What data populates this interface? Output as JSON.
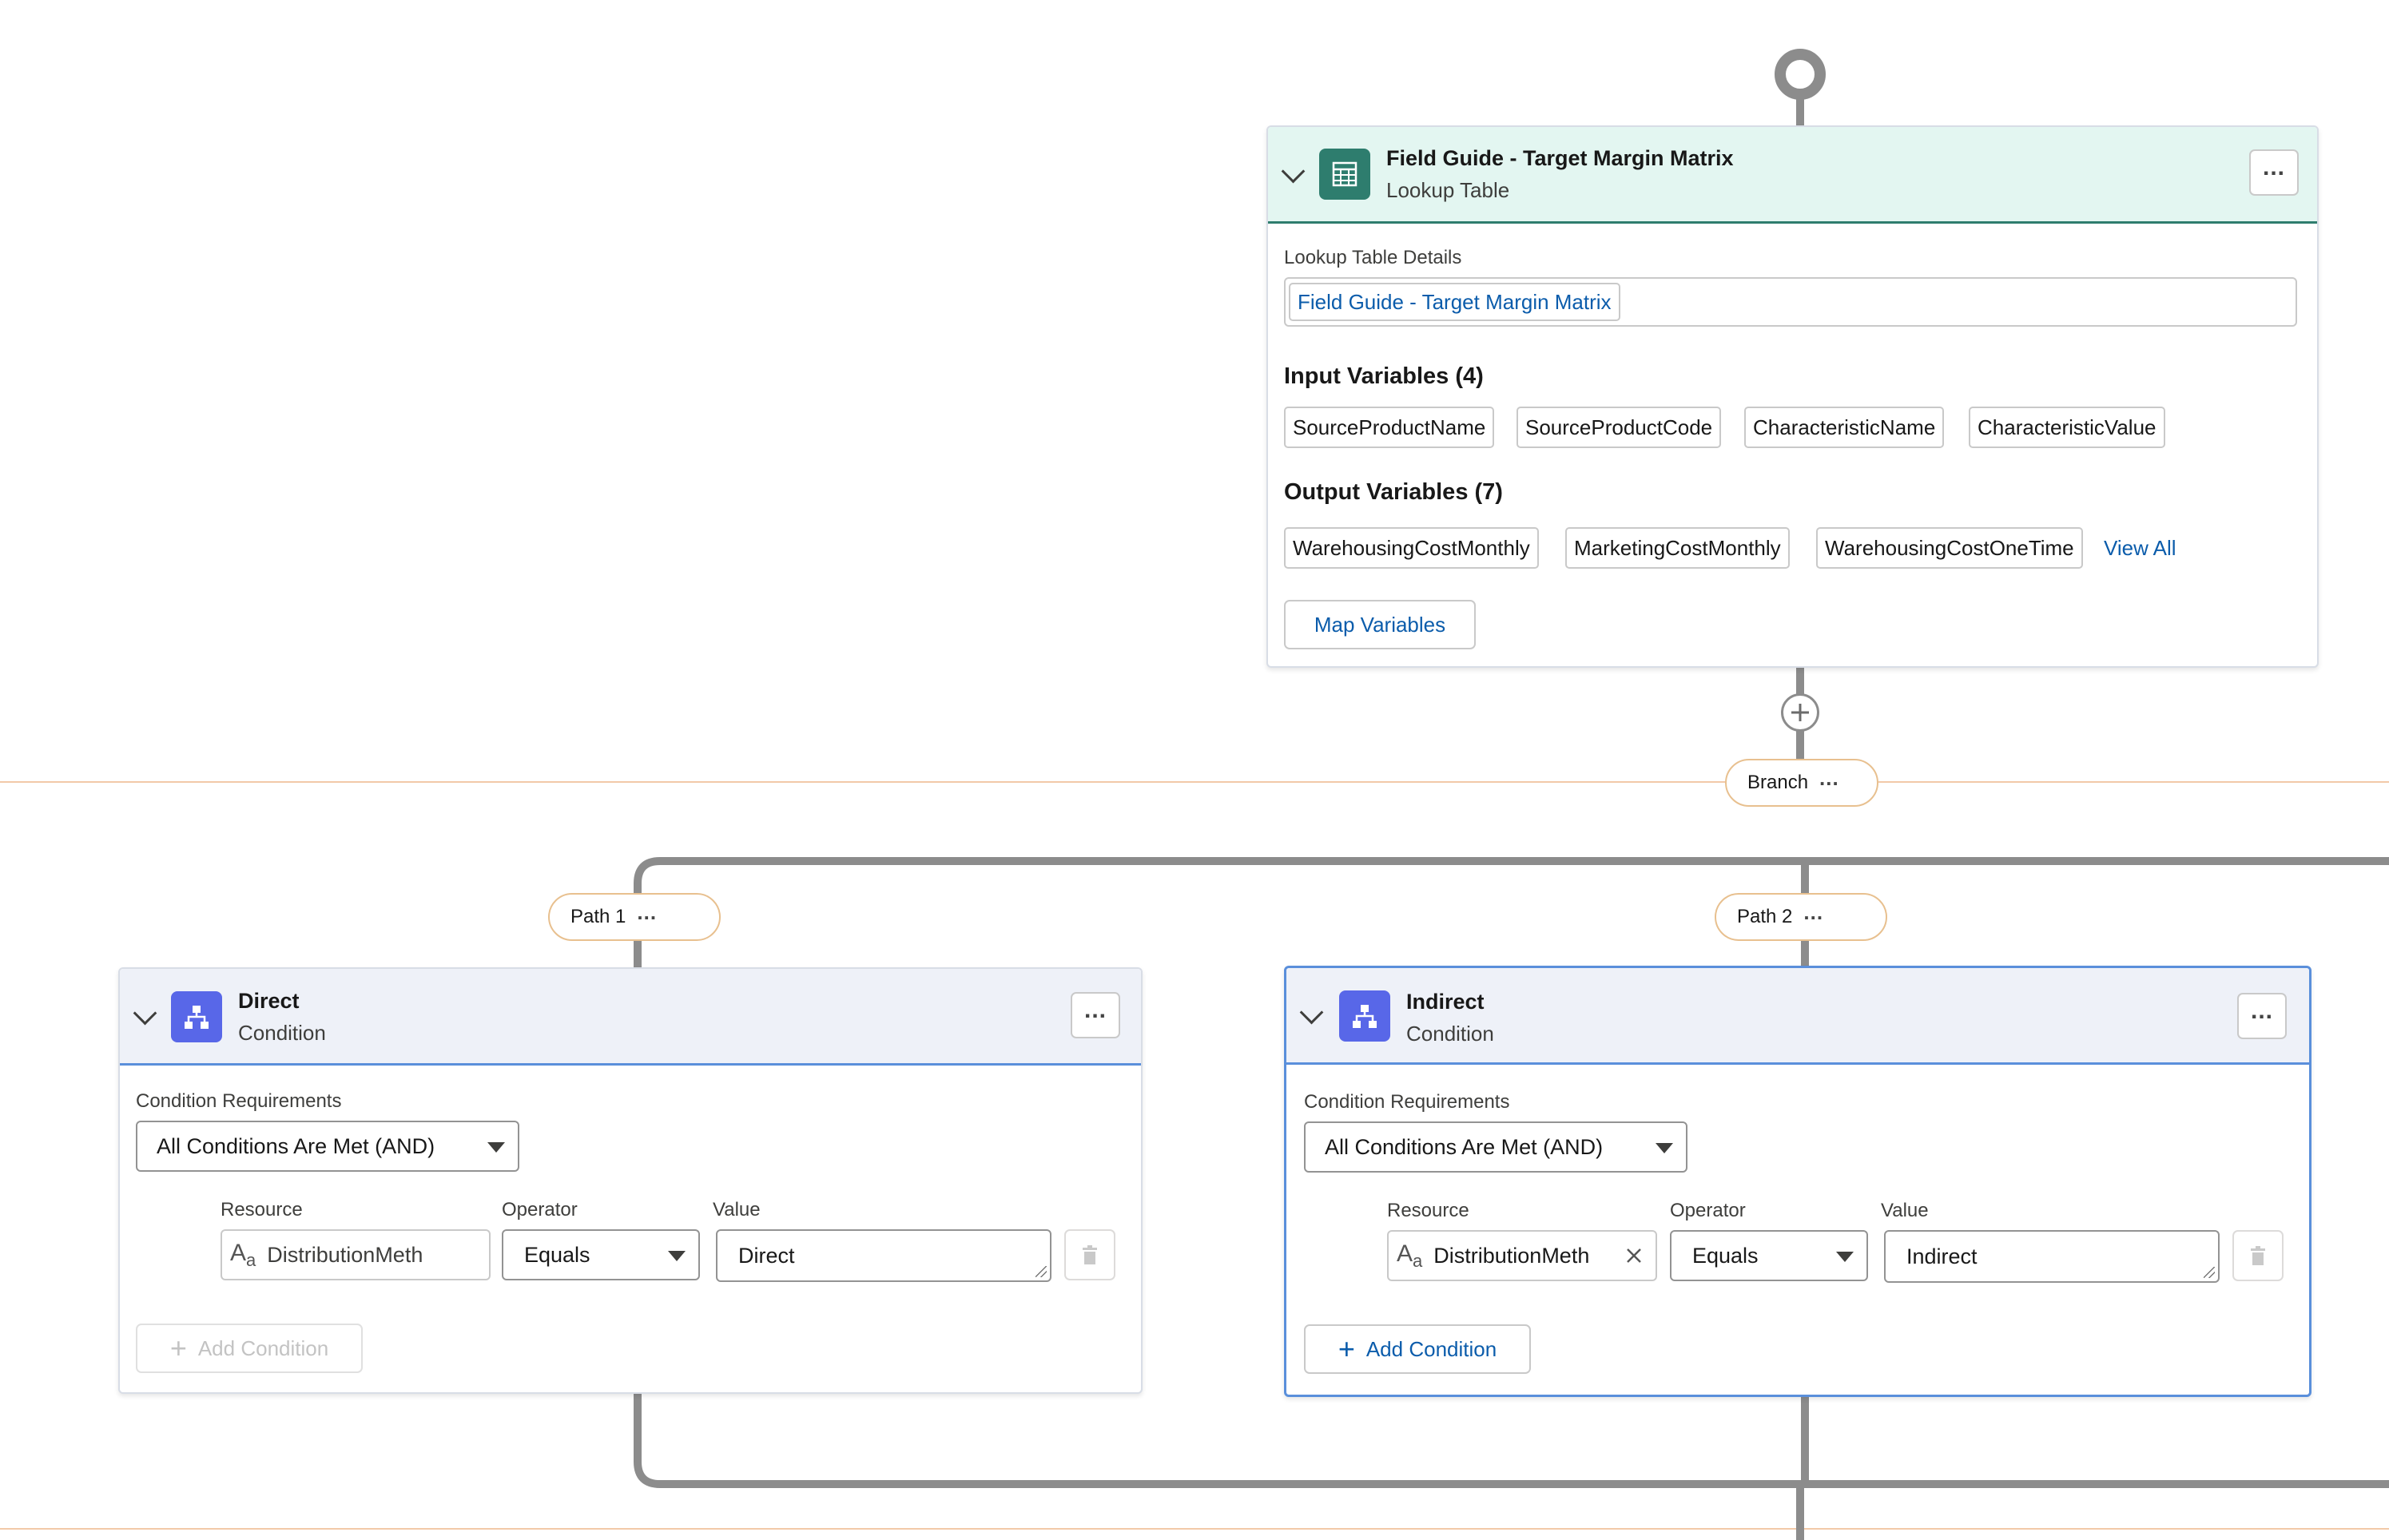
{
  "lookup_card": {
    "title": "Field Guide - Target Margin Matrix",
    "subtitle": "Lookup Table",
    "details_label": "Lookup Table Details",
    "details_value": "Field Guide - Target Margin Matrix",
    "input_heading": "Input Variables (4)",
    "inputs": [
      "SourceProductName",
      "SourceProductCode",
      "CharacteristicName",
      "CharacteristicValue"
    ],
    "output_heading": "Output Variables (7)",
    "outputs": [
      "WarehousingCostMonthly",
      "MarketingCostMonthly",
      "WarehousingCostOneTime"
    ],
    "view_all": "View All",
    "map_button": "Map Variables"
  },
  "branch": {
    "label": "Branch"
  },
  "paths": [
    {
      "label": "Path 1"
    },
    {
      "label": "Path 2"
    }
  ],
  "conditions": [
    {
      "title": "Direct",
      "subtitle": "Condition",
      "req_label": "Condition Requirements",
      "req_value": "All Conditions Are Met (AND)",
      "resource_label": "Resource",
      "resource_value": "DistributionMeth",
      "operator_label": "Operator",
      "operator_value": "Equals",
      "value_label": "Value",
      "value": "Direct",
      "add_condition": "Add Condition"
    },
    {
      "title": "Indirect",
      "subtitle": "Condition",
      "req_label": "Condition Requirements",
      "req_value": "All Conditions Are Met (AND)",
      "resource_label": "Resource",
      "resource_value": "DistributionMeth",
      "operator_label": "Operator",
      "operator_value": "Equals",
      "value_label": "Value",
      "value": "Indirect",
      "add_condition": "Add Condition"
    }
  ],
  "colors": {
    "lookup_header": "#e3f6f1",
    "lookup_icon": "#2e7d6e",
    "condition_header": "#eef1f8",
    "condition_icon": "#5867e8",
    "connector": "#8c8c8c",
    "branch_line": "#f2c9a8",
    "link": "#0b5cab",
    "selected_border": "#5a8fdb"
  }
}
